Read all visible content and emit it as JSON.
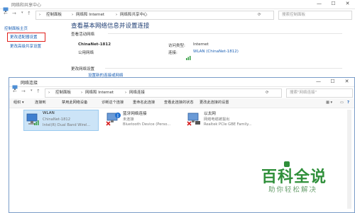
{
  "bg_window": {
    "title": "网络和共享中心",
    "controls": {
      "minimize": "—",
      "maximize": "☐",
      "close": "✕"
    },
    "breadcrumb": [
      "控制面板",
      "网络和 Internet",
      "网络和共享中心"
    ],
    "search_placeholder": "搜索控制面板",
    "sidebar": [
      "控制面板主页",
      "更改适配器设置",
      "更改高级共享设置"
    ],
    "heading": "查看基本网络信息并设置连接",
    "active_networks_label": "查看活动网络",
    "network_name": "ChinaNet-1812",
    "network_type": "公用网络",
    "access_type_label": "访问类型:",
    "access_type_value": "Internet",
    "connection_label": "连接:",
    "connection_value": "WLAN (ChinaNet-1812)",
    "change_settings_label": "更改网络设置",
    "setup_link": "设置新的连接或网络"
  },
  "fg_window": {
    "title": "网络连接",
    "controls": {
      "minimize": "—",
      "maximize": "☐",
      "close": "✕"
    },
    "breadcrumb": [
      "控制面板",
      "网络和 Internet",
      "网络连接"
    ],
    "search_placeholder": "搜索\"网络连接\"",
    "toolbar": [
      "组织 ▾",
      "连接到",
      "禁用此网络设备",
      "诊断这个连接",
      "重命名此连接",
      "查看此连接的状态",
      "更改此连接的设置"
    ],
    "adapters": [
      {
        "name": "WLAN",
        "line1": "ChinaNet-1812",
        "line2": "Intel(R) Dual Band Wirel...",
        "status": "ok"
      },
      {
        "name": "蓝牙网络连接",
        "line1": "未连接",
        "line2": "Bluetooth Device (Perso...",
        "status": "disconnected"
      },
      {
        "name": "以太网",
        "line1": "网络电缆被拔出",
        "line2": "Realtek PCIe GBE Family...",
        "status": "disconnected"
      }
    ]
  },
  "watermark": {
    "title": "百科全说",
    "subtitle": "助你轻松解决"
  },
  "colors": {
    "link": "#1a5fb4",
    "highlight": "#e0201b",
    "heading": "#1e3d73",
    "watermark": "#2f8f3a"
  }
}
